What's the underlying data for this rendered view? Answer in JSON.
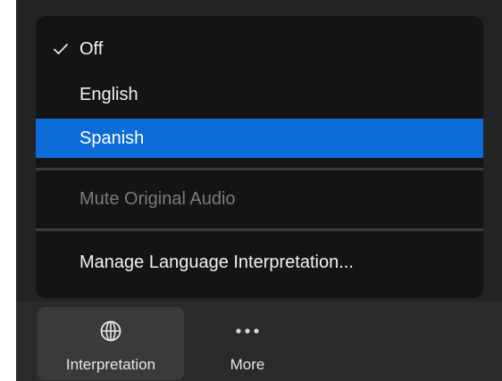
{
  "menu": {
    "items": [
      {
        "label": "Off",
        "checked": true
      },
      {
        "label": "English"
      },
      {
        "label": "Spanish",
        "highlighted": true
      },
      {
        "label": "Mute Original Audio",
        "disabled": true
      },
      {
        "label": "Manage Language Interpretation..."
      }
    ]
  },
  "toolbar": {
    "interpretation_label": "Interpretation",
    "more_label": "More"
  },
  "colors": {
    "highlight": "#0e6cd9",
    "menu_bg": "#141414",
    "toolbar_bg": "#2a2a2a",
    "disabled_text": "#7b7b7b"
  },
  "icons": {
    "check": "checkmark-icon",
    "interpretation": "globe-icon",
    "more": "ellipsis-icon"
  }
}
